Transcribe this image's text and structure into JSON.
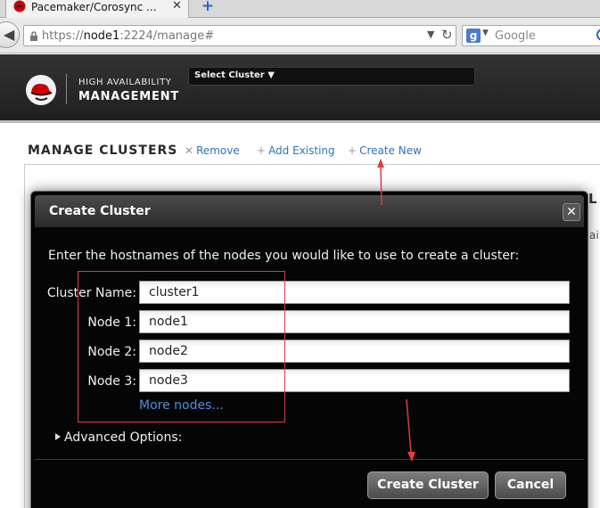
{
  "browser": {
    "tab_title": "Pacemaker/Corosync ...",
    "tab_close": "✕",
    "new_tab": "+",
    "url_prefix": "https://",
    "url_host": "node1",
    "url_rest": ":2224/manage#",
    "search_placeholder": "Google",
    "search_engine_letter": "g"
  },
  "app": {
    "brand_line1": "HIGH AVAILABILITY",
    "brand_line2": "MANAGEMENT",
    "cluster_select": "Select Cluster ▼"
  },
  "toolbar": {
    "title": "MANAGE CLUSTERS",
    "remove": "Remove",
    "add_existing": "Add Existing",
    "create_new": "Create New",
    "remove_icon": "✕",
    "add_icon": "+",
    "create_icon": "+"
  },
  "background": {
    "heading_fragment": "L",
    "text_fragment": "ai"
  },
  "modal": {
    "title": "Create Cluster",
    "close": "✕",
    "intro": "Enter the hostnames of the nodes you would like to use to create a cluster:",
    "fields": {
      "cluster_name": {
        "label": "Cluster Name:",
        "value": "cluster1"
      },
      "node1": {
        "label": "Node 1:",
        "value": "node1"
      },
      "node2": {
        "label": "Node 2:",
        "value": "node2"
      },
      "node3": {
        "label": "Node 3:",
        "value": "node3"
      }
    },
    "more_nodes": "More nodes...",
    "advanced_options": "Advanced Options:",
    "create_button": "Create Cluster",
    "cancel_button": "Cancel"
  },
  "colors": {
    "link": "#3273b5",
    "annotation": "#e23c3c",
    "modal_bg": "#050505"
  }
}
